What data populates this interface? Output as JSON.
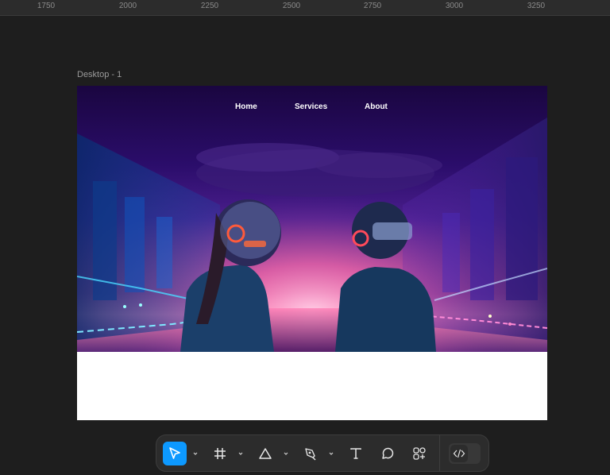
{
  "ruler": {
    "labels": [
      "1750",
      "2000",
      "2250",
      "2500",
      "2750",
      "3000",
      "3250"
    ]
  },
  "canvas": {
    "frame_label": "Desktop - 1"
  },
  "design": {
    "nav": {
      "home": "Home",
      "services": "Services",
      "about": "About"
    },
    "hero_image": "two people wearing vr headsets in neon city"
  },
  "toolbar": {
    "tools": [
      {
        "name": "move-tool",
        "icon": "cursor-arrow-icon",
        "active": true
      },
      {
        "name": "frame-tool",
        "icon": "frame-hash-icon"
      },
      {
        "name": "shape-tool",
        "icon": "triangle-icon"
      },
      {
        "name": "pen-tool",
        "icon": "pen-icon"
      },
      {
        "name": "text-tool",
        "icon": "text-t-icon"
      },
      {
        "name": "comment-tool",
        "icon": "speech-bubble-icon"
      },
      {
        "name": "actions-tool",
        "icon": "shapes-plus-icon"
      }
    ],
    "dev_mode_icon": "code-brackets-icon"
  },
  "colors": {
    "canvas_bg": "#1e1e1e",
    "accent": "#0d99ff"
  }
}
